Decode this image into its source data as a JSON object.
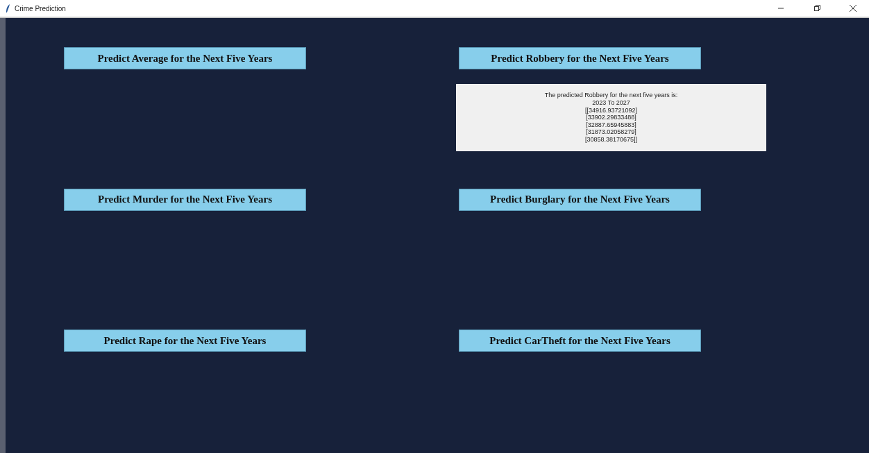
{
  "window": {
    "title": "Crime Prediction"
  },
  "panels": [
    {
      "button": "Predict Average for the Next Five Years"
    },
    {
      "button": "Predict Robbery for the Next Five Years",
      "result": [
        "The predicted Robbery for the next five years is:",
        "2023 To 2027",
        "[[34916.93721092]",
        "[33902.29833488]",
        "[32887.65945883]",
        "[31873.02058279]",
        "[30858.38170675]]"
      ]
    },
    {
      "button": "Predict Murder for the Next Five Years"
    },
    {
      "button": "Predict Burglary for the Next Five Years"
    },
    {
      "button": "Predict Rape for the Next Five Years"
    },
    {
      "button": "Predict CarTheft for the Next Five Years"
    }
  ]
}
